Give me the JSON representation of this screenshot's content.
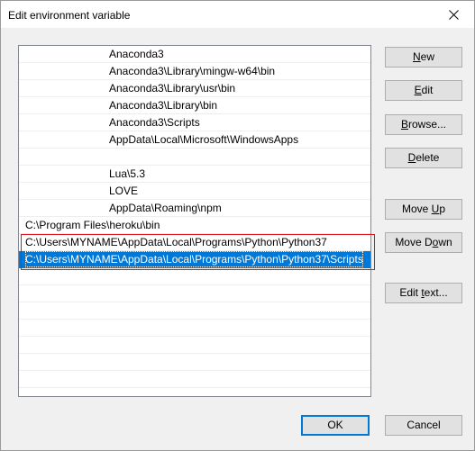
{
  "window": {
    "title": "Edit environment variable"
  },
  "paths": [
    {
      "text": "Anaconda3",
      "clipped": true
    },
    {
      "text": "Anaconda3\\Library\\mingw-w64\\bin",
      "clipped": true
    },
    {
      "text": "Anaconda3\\Library\\usr\\bin",
      "clipped": true
    },
    {
      "text": "Anaconda3\\Library\\bin",
      "clipped": true
    },
    {
      "text": "Anaconda3\\Scripts",
      "clipped": true
    },
    {
      "text": "AppData\\Local\\Microsoft\\WindowsApps",
      "clipped": true
    },
    {
      "text": "",
      "clipped": true
    },
    {
      "text": "Lua\\5.3",
      "clipped": true
    },
    {
      "text": "LOVE",
      "clipped": true
    },
    {
      "text": "AppData\\Roaming\\npm",
      "clipped": true
    },
    {
      "text": "C:\\Program Files\\heroku\\bin",
      "clipped": false
    },
    {
      "text": "C:\\Users\\MYNAME\\AppData\\Local\\Programs\\Python\\Python37",
      "clipped": false
    },
    {
      "text": "C:\\Users\\MYNAME\\AppData\\Local\\Programs\\Python\\Python37\\Scripts",
      "clipped": false,
      "selected": true
    },
    {
      "text": "",
      "clipped": false
    },
    {
      "text": "",
      "clipped": false
    },
    {
      "text": "",
      "clipped": false
    },
    {
      "text": "",
      "clipped": false
    },
    {
      "text": "",
      "clipped": false
    },
    {
      "text": "",
      "clipped": false
    },
    {
      "text": "",
      "clipped": false
    }
  ],
  "buttons": {
    "new": {
      "pre": "",
      "key": "N",
      "post": "ew"
    },
    "edit": {
      "pre": "",
      "key": "E",
      "post": "dit"
    },
    "browse": {
      "pre": "",
      "key": "B",
      "post": "rowse..."
    },
    "delete": {
      "pre": "",
      "key": "D",
      "post": "elete"
    },
    "move_up": {
      "pre": "Move ",
      "key": "U",
      "post": "p"
    },
    "move_down": {
      "pre": "Move D",
      "key": "o",
      "post": "wn"
    },
    "edit_text": {
      "pre": "Edit ",
      "key": "t",
      "post": "ext..."
    },
    "ok": {
      "label": "OK"
    },
    "cancel": {
      "label": "Cancel"
    }
  },
  "colors": {
    "selection": "#0078d7",
    "highlight_border": "#e0141e"
  }
}
